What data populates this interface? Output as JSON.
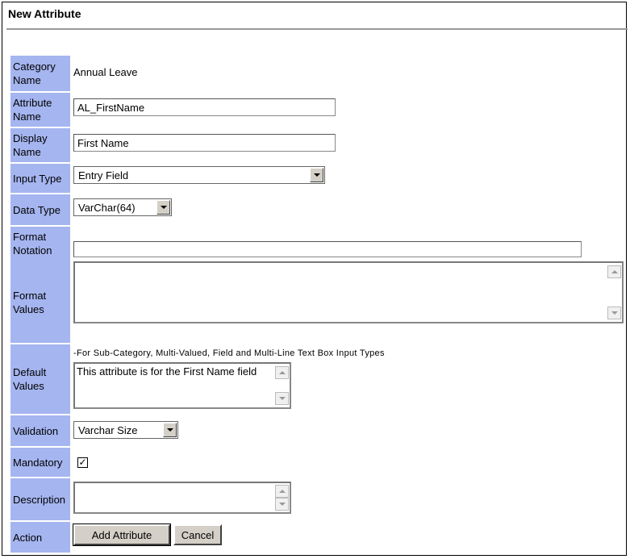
{
  "page": {
    "title": "New Attribute"
  },
  "labels": {
    "category_name": "Category Name",
    "attribute_name": "Attribute Name",
    "display_name": "Display Name",
    "input_type": "Input Type",
    "data_type": "Data Type",
    "format_notation": "Format Notation",
    "format_values": "Format Values",
    "default_values": "Default Values",
    "validation": "Validation",
    "mandatory": "Mandatory",
    "description": "Description",
    "action": "Action"
  },
  "fields": {
    "category_name": "Annual Leave",
    "attribute_name": "AL_FirstName",
    "display_name": "First Name",
    "input_type": "Entry Field",
    "data_type": "VarChar(64)",
    "format_notation": "",
    "format_values": "",
    "default_values_note": "-For Sub-Category, Multi-Valued, Field and Multi-Line Text Box Input Types",
    "default_values": "This attribute is for the First Name field",
    "validation": "Varchar Size",
    "mandatory_checked": true,
    "mandatory_mark": "✓",
    "description": ""
  },
  "buttons": {
    "add": "Add Attribute",
    "cancel": "Cancel"
  }
}
